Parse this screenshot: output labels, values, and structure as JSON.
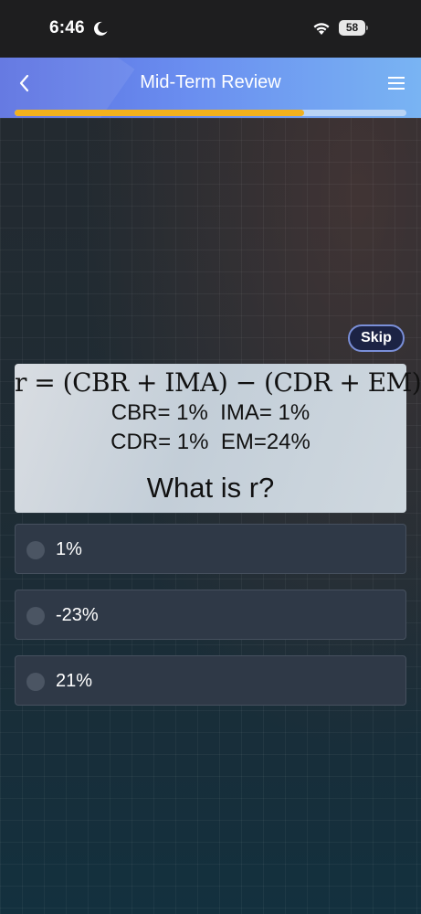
{
  "status_bar": {
    "time": "6:46",
    "battery": "58"
  },
  "header": {
    "title": "Mid-Term Review",
    "progress": 0.74
  },
  "skip": {
    "label": "Skip"
  },
  "question": {
    "formula": "r = (CBR + IMA) − (CDR + EM)",
    "line1": "CBR= 1%  IMA= 1%",
    "line2": "CDR= 1%  EM=24%",
    "prompt": "What is r?"
  },
  "options": [
    {
      "label": "1%"
    },
    {
      "label": "-23%"
    },
    {
      "label": "21%"
    }
  ],
  "colors": {
    "header_start": "#5a6fe0",
    "header_end": "#79b4f3",
    "progress_fill": "#f2b11d",
    "progress_track": "#b9d4f5",
    "option_bg": "#2f3947"
  }
}
